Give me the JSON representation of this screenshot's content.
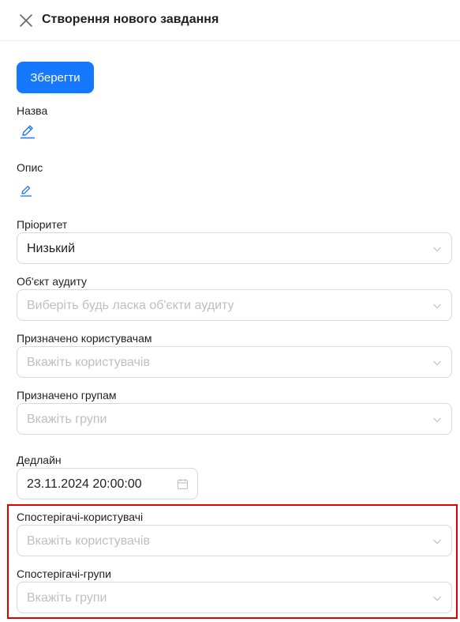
{
  "header": {
    "title": "Створення нового завдання",
    "close_icon": "close-icon"
  },
  "toolbar": {
    "save_label": "Зберегти"
  },
  "fields": {
    "name": {
      "label": "Назва",
      "icon": "pencil-icon"
    },
    "description": {
      "label": "Опис",
      "icon": "pencil-icon"
    },
    "priority": {
      "label": "Пріоритет",
      "value": "Низький"
    },
    "audit_object": {
      "label": "Об'єкт аудиту",
      "placeholder": "Виберіть будь ласка об'єкти аудиту"
    },
    "assigned_users": {
      "label": "Призначено користувачам",
      "placeholder": "Вкажіть користувачів"
    },
    "assigned_groups": {
      "label": "Призначено групам",
      "placeholder": "Вкажіть групи"
    },
    "deadline": {
      "label": "Дедлайн",
      "value": "23.11.2024 20:00:00",
      "icon": "calendar-icon"
    },
    "observer_users": {
      "label": "Спостерігачі-користувачі",
      "placeholder": "Вкажіть користувачів"
    },
    "observer_groups": {
      "label": "Спостерігачі-групи",
      "placeholder": "Вкажіть групи"
    }
  },
  "colors": {
    "primary": "#1677ff",
    "highlight": "#e00000",
    "placeholder": "#bfbfbf",
    "border": "#d9d9d9"
  }
}
